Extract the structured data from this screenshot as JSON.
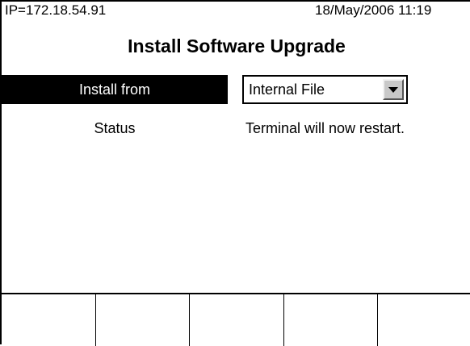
{
  "status_bar": {
    "ip": "IP=172.18.54.91",
    "datetime": "18/May/2006 11:19"
  },
  "title": "Install Software Upgrade",
  "install_from": {
    "label": "Install from",
    "selected": "Internal File",
    "icon": "chevron-down-icon"
  },
  "status": {
    "label": "Status",
    "value": "Terminal will now restart."
  },
  "softkeys": [
    "",
    "",
    "",
    "",
    ""
  ],
  "colors": {
    "background": "#ffffff",
    "highlight": "#000000",
    "button_face": "#c9c9c9"
  }
}
